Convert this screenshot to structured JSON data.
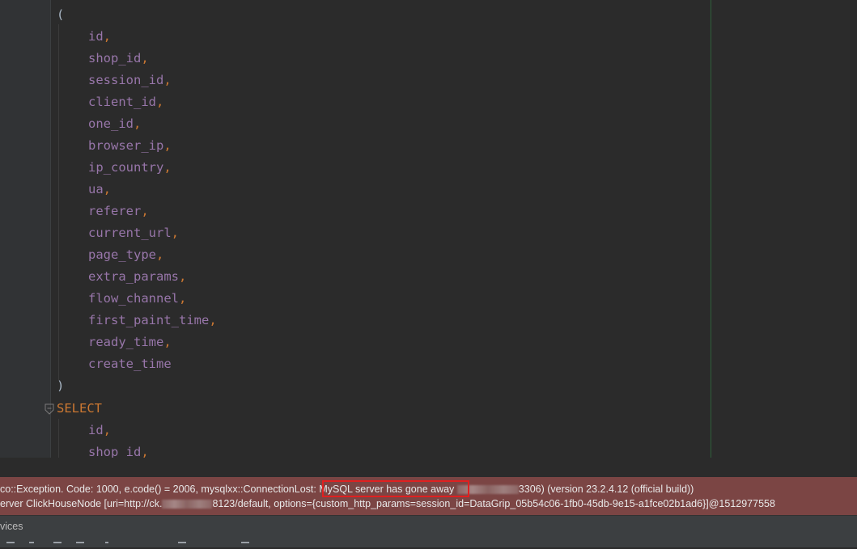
{
  "editor": {
    "open_paren": "(",
    "close_paren": ")",
    "columns": [
      "id",
      "shop_id",
      "session_id",
      "client_id",
      "one_id",
      "browser_ip",
      "ip_country",
      "ua",
      "referer",
      "current_url",
      "page_type",
      "extra_params",
      "flow_channel",
      "first_paint_time",
      "ready_time",
      "create_time"
    ],
    "select_keyword": "SELECT",
    "select_columns": [
      "id",
      "shop_id"
    ]
  },
  "error": {
    "line1_prefix": "co::Exception. Code: 1000, e.code() = 2006, mysqlxx::ConnectionLost: ",
    "line1_highlight": "MySQL server has gone away",
    "line1_suffix": "3306) (version 23.2.4.12 (official build))",
    "line2_prefix": "erver ClickHouseNode [uri=http://ck.",
    "line2_suffix": "8123/default, options={custom_http_params=session_id=DataGrip_05b54c06-1fb0-45db-9e15-a1fce02b1ad6}]@1512977558"
  },
  "bottom_panel": {
    "title": "vices"
  },
  "colors": {
    "keyword": "#cc7832",
    "identifier": "#9876aa",
    "error_background": "#7b4544",
    "highlight_border": "#e02020"
  }
}
